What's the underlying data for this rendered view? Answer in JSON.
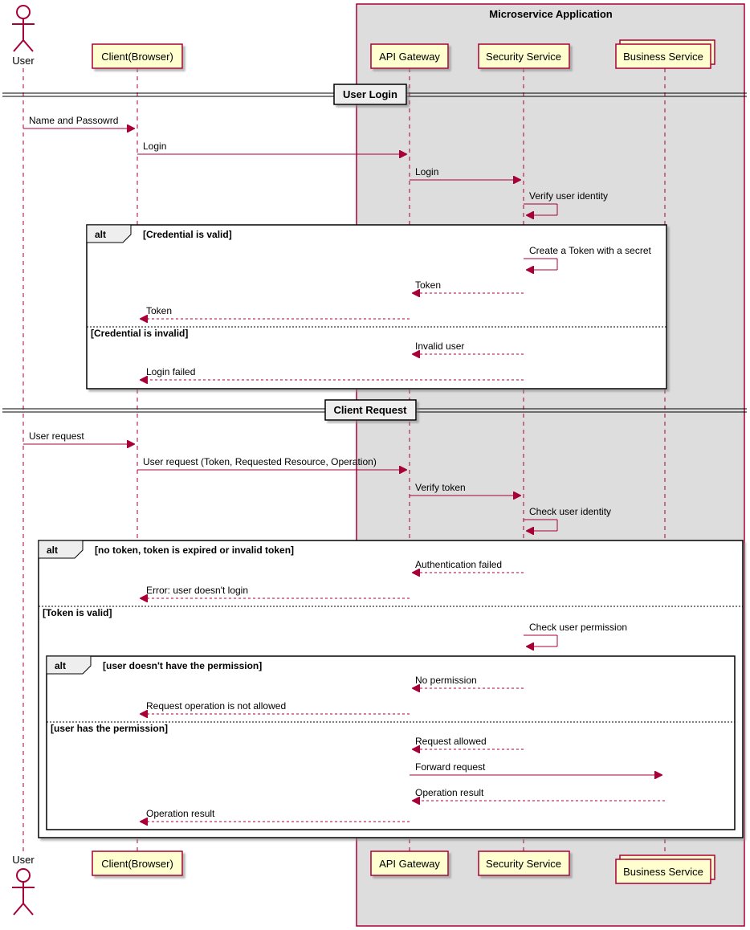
{
  "box_title": "Microservice Application",
  "participants": {
    "user": "User",
    "client": "Client(Browser)",
    "gateway": "API Gateway",
    "security": "Security Service",
    "business": "Business Service"
  },
  "dividers": {
    "login": "User Login",
    "request": "Client Request"
  },
  "messages": {
    "m1": "Name and Passowrd",
    "m2": "Login",
    "m3": "Login",
    "m4": "Verify user identity",
    "m5": "Create a Token with a secret",
    "m6": "Token",
    "m7": "Token",
    "m8": "Invalid user",
    "m9": "Login failed",
    "m10": "User request",
    "m11": "User request (Token, Requested Resource, Operation)",
    "m12": "Verify token",
    "m13": "Check user identity",
    "m14": "Authentication failed",
    "m15": "Error: user doesn't login",
    "m16": "Check user permission",
    "m17": "No permission",
    "m18": "Request operation is not allowed",
    "m19": "Request allowed",
    "m20": "Forward request",
    "m21": "Operation result",
    "m22": "Operation result"
  },
  "alt": {
    "label": "alt",
    "guard1a": "[Credential is valid]",
    "guard1b": "[Credential is invalid]",
    "guard2a": "[no token, token is expired or invalid token]",
    "guard2b": "[Token is valid]",
    "guard3a": "[user doesn't have the permission]",
    "guard3b": "[user has the permission]"
  }
}
